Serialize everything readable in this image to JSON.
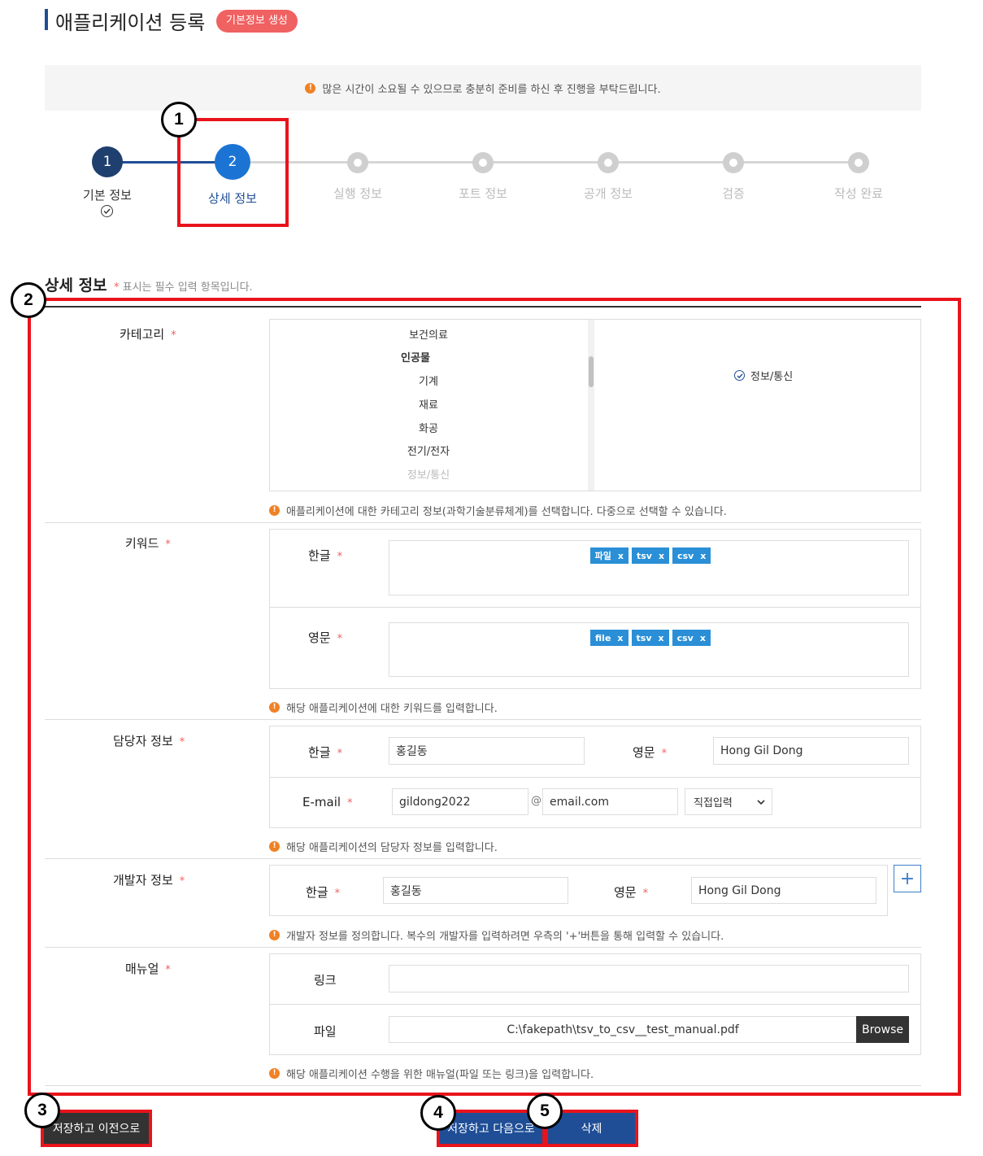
{
  "header": {
    "title": "애플리케이션 등록",
    "badge": "기본정보 생성"
  },
  "notice": {
    "text": "많은 시간이 소요될 수 있으므로 충분히 준비를 하신 후 진행을 부탁드립니다.",
    "icon": "warning-icon"
  },
  "stepper": {
    "steps": [
      {
        "number": "1",
        "label": "기본 정보",
        "state": "done"
      },
      {
        "number": "2",
        "label": "상세 정보",
        "state": "active"
      },
      {
        "number": "",
        "label": "실행 정보",
        "state": "pending"
      },
      {
        "number": "",
        "label": "포트 정보",
        "state": "pending"
      },
      {
        "number": "",
        "label": "공개 정보",
        "state": "pending"
      },
      {
        "number": "",
        "label": "검증",
        "state": "pending"
      },
      {
        "number": "",
        "label": "작성 완료",
        "state": "pending"
      }
    ]
  },
  "annotations": [
    "1",
    "2",
    "3",
    "4",
    "5"
  ],
  "section": {
    "title": "상세 정보",
    "note_star": "*",
    "note": "표시는 필수 입력 항목입니다."
  },
  "category": {
    "label": "카테고리",
    "req": "*",
    "items": [
      "보건의료",
      "인공물",
      "기계",
      "재료",
      "화공",
      "전기/전자",
      "정보/통신"
    ],
    "selected": "정보/통신",
    "helper": "애플리케이션에 대한 카테고리 정보(과학기술분류체계)를 선택합니다. 다중으로 선택할 수 있습니다."
  },
  "keyword": {
    "label": "키워드",
    "req": "*",
    "korean_label": "한글",
    "english_label": "영문",
    "korean_tags": [
      "파일",
      "tsv",
      "csv"
    ],
    "english_tags": [
      "file",
      "tsv",
      "csv"
    ],
    "remove_glyph": "x",
    "helper": "해당 애플리케이션에 대한 키워드를 입력합니다."
  },
  "contact": {
    "label": "담당자 정보",
    "req": "*",
    "korean_label": "한글",
    "korean_value": "홍길동",
    "english_label": "영문",
    "english_value": "Hong Gil Dong",
    "email_label": "E-mail",
    "email_id": "gildong2022",
    "at": "@",
    "email_domain": "email.com",
    "domain_select": "직접입력",
    "helper": "해당 애플리케이션의 담당자 정보를 입력합니다."
  },
  "developer": {
    "label": "개발자 정보",
    "req": "*",
    "korean_label": "한글",
    "korean_value": "홍길동",
    "english_label": "영문",
    "english_value": "Hong Gil Dong",
    "add_glyph": "+",
    "helper": "개발자 정보를 정의합니다. 복수의 개발자를 입력하려면 우측의 '+'버튼을 통해 입력할 수 있습니다."
  },
  "manual": {
    "label": "매뉴얼",
    "req": "*",
    "link_label": "링크",
    "link_value": "",
    "file_label": "파일",
    "file_value": "C:\\fakepath\\tsv_to_csv__test_manual.pdf",
    "browse": "Browse",
    "helper": "해당 애플리케이션 수행을 위한 매뉴얼(파일 또는 링크)을 입력합니다."
  },
  "buttons": {
    "prev": "저장하고 이전으로",
    "next": "저장하고 다음으로",
    "delete": "삭제"
  },
  "colors": {
    "primary_dark": "#1f4e96",
    "primary": "#1b74d3",
    "annotation_red": "#e8131b",
    "tag_blue": "#2a8fd6",
    "badge_red": "#f06161",
    "warning_orange": "#f08125"
  }
}
